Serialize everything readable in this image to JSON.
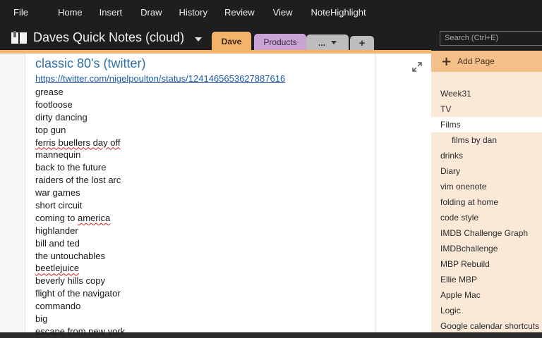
{
  "menu": [
    "File",
    "Home",
    "Insert",
    "Draw",
    "History",
    "Review",
    "View",
    "NoteHighlight"
  ],
  "notebook": {
    "title": "Daves Quick Notes (cloud)"
  },
  "sections": [
    {
      "label": "Dave",
      "color": "#f3b36b",
      "active": true
    },
    {
      "label": "Products",
      "color": "#c9a3d3",
      "active": false
    }
  ],
  "section_more": "...",
  "section_add": "+",
  "search": {
    "placeholder": "Search (Ctrl+E)"
  },
  "page": {
    "title": "classic 80's (twitter)",
    "link": "https://twitter.com/nigelpoulton/status/1241465653627887616",
    "items": [
      "grease",
      "footloose",
      "dirty dancing",
      "top gun",
      "ferris buellers day off",
      "mannequin",
      "back to the future",
      "raiders of the lost arc",
      "war games",
      "short circuit",
      "coming to america",
      "highlander",
      "bill and ted",
      "the untouchables",
      "beetlejuice",
      "beverly hills copy",
      "flight of the navigator",
      "commando",
      "big",
      "escape from new york"
    ]
  },
  "page_pane": {
    "add_label": "Add Page",
    "pages": [
      {
        "label": "Week31",
        "sub": false,
        "selected": false
      },
      {
        "label": "TV",
        "sub": false,
        "selected": false
      },
      {
        "label": "Films",
        "sub": false,
        "selected": true
      },
      {
        "label": "films by dan",
        "sub": true,
        "selected": false
      },
      {
        "label": "drinks",
        "sub": false,
        "selected": false
      },
      {
        "label": "Diary",
        "sub": false,
        "selected": false
      },
      {
        "label": "vim onenote",
        "sub": false,
        "selected": false
      },
      {
        "label": "folding at home",
        "sub": false,
        "selected": false
      },
      {
        "label": "code style",
        "sub": false,
        "selected": false
      },
      {
        "label": "IMDB Challenge Graph",
        "sub": false,
        "selected": false
      },
      {
        "label": "IMDBchallenge",
        "sub": false,
        "selected": false
      },
      {
        "label": "MBP Rebuild",
        "sub": false,
        "selected": false
      },
      {
        "label": "Ellie MBP",
        "sub": false,
        "selected": false
      },
      {
        "label": "Apple Mac",
        "sub": false,
        "selected": false
      },
      {
        "label": "Logic",
        "sub": false,
        "selected": false
      },
      {
        "label": "Google calendar shortcuts",
        "sub": false,
        "selected": false
      }
    ]
  }
}
